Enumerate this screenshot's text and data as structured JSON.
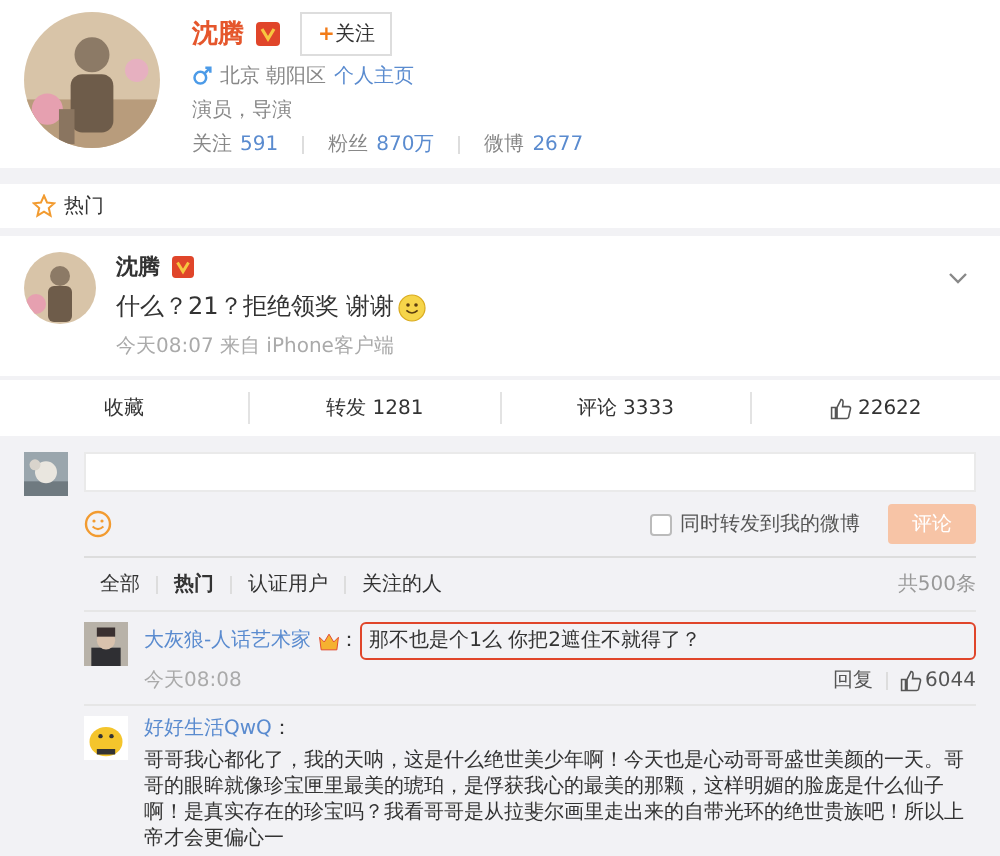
{
  "profile": {
    "name": "沈腾",
    "plus": "+",
    "follow": "关注",
    "location": "北京 朝阳区",
    "homepage": "个人主页",
    "bio": "演员，导演",
    "stats": [
      {
        "label": "关注",
        "value": "591"
      },
      {
        "label": "粉丝",
        "value": "870万"
      },
      {
        "label": "微博",
        "value": "2677"
      }
    ]
  },
  "section_tab": "热门",
  "post": {
    "name": "沈腾",
    "text": "什么？21？拒绝领奖 谢谢",
    "meta": "今天08:07 来自 iPhone客户端"
  },
  "actions": [
    {
      "kind": "text",
      "label": "收藏"
    },
    {
      "kind": "text",
      "label": "转发 1281"
    },
    {
      "kind": "text",
      "label": "评论 3333"
    },
    {
      "kind": "like",
      "label": "22622"
    }
  ],
  "composer": {
    "repost": {
      "label": "同时转发到我的微博",
      "checked": false
    },
    "button": "评论"
  },
  "filters": [
    {
      "label": "全部",
      "selected": false
    },
    {
      "label": "热门",
      "selected": true
    },
    {
      "label": "认证用户",
      "selected": false
    },
    {
      "label": "关注的人",
      "selected": false
    }
  ],
  "total": "共500条",
  "comments": [
    {
      "user": "大灰狼-人话艺术家",
      "sep": "：",
      "text": "那不也是个1么 你把2遮住不就得了？",
      "highlighted": true,
      "time": "今天08:08",
      "reply": "回复",
      "likes": "6044"
    },
    {
      "user": "好好生活QwQ",
      "sep": "：",
      "text": "哥哥我心都化了，我的天呐，这是什么绝世美少年啊！今天也是心动哥哥盛世美颜的一天。哥哥的眼眸就像珍宝匣里最美的琥珀，是俘获我心的最美的那颗，这样明媚的脸庞是什么仙子啊！是真实存在的珍宝吗？我看哥哥是从拉斐尔画里走出来的自带光环的绝世贵族吧！所以上帝才会更偏心一",
      "highlighted": false
    }
  ]
}
